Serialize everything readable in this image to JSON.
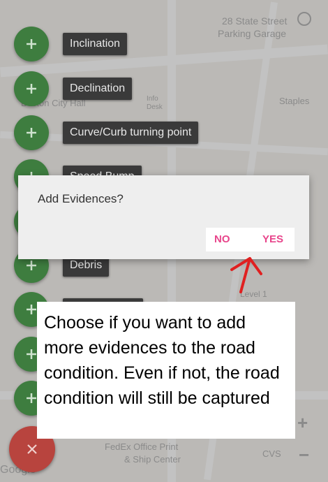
{
  "map": {
    "labels": {
      "state_street": "28 State Street",
      "parking_garage": "Parking Garage",
      "city_hall": "Boston City Hall",
      "staples": "Staples",
      "info_desk_1": "Info",
      "info_desk_2": "Desk",
      "level": "Level 1",
      "fedex_1": "FedEx Office Print",
      "fedex_2": "& Ship Center",
      "cvs": "CVS",
      "google": "Google"
    },
    "zoom_in": "+",
    "zoom_out": "−"
  },
  "menu": {
    "items": [
      {
        "label": "Inclination"
      },
      {
        "label": "Declination"
      },
      {
        "label": "Curve/Curb turning point"
      },
      {
        "label": "Speed Bump"
      },
      {
        "label": ""
      },
      {
        "label": "Debris"
      },
      {
        "label": ""
      },
      {
        "label": ""
      },
      {
        "label": ""
      }
    ],
    "close_symbol": "×"
  },
  "dialog": {
    "title": "Add Evidences?",
    "no_label": "NO",
    "yes_label": "YES"
  },
  "tooltip": {
    "text": "Choose if you want to add more evidences to the road condition. Even if not, the road condition will still be captured"
  },
  "colors": {
    "fab_green": "#3e7d3f",
    "close_red": "#b8443e",
    "dialog_button_pink": "#e8458b",
    "annotation_arrow": "#e02020"
  }
}
